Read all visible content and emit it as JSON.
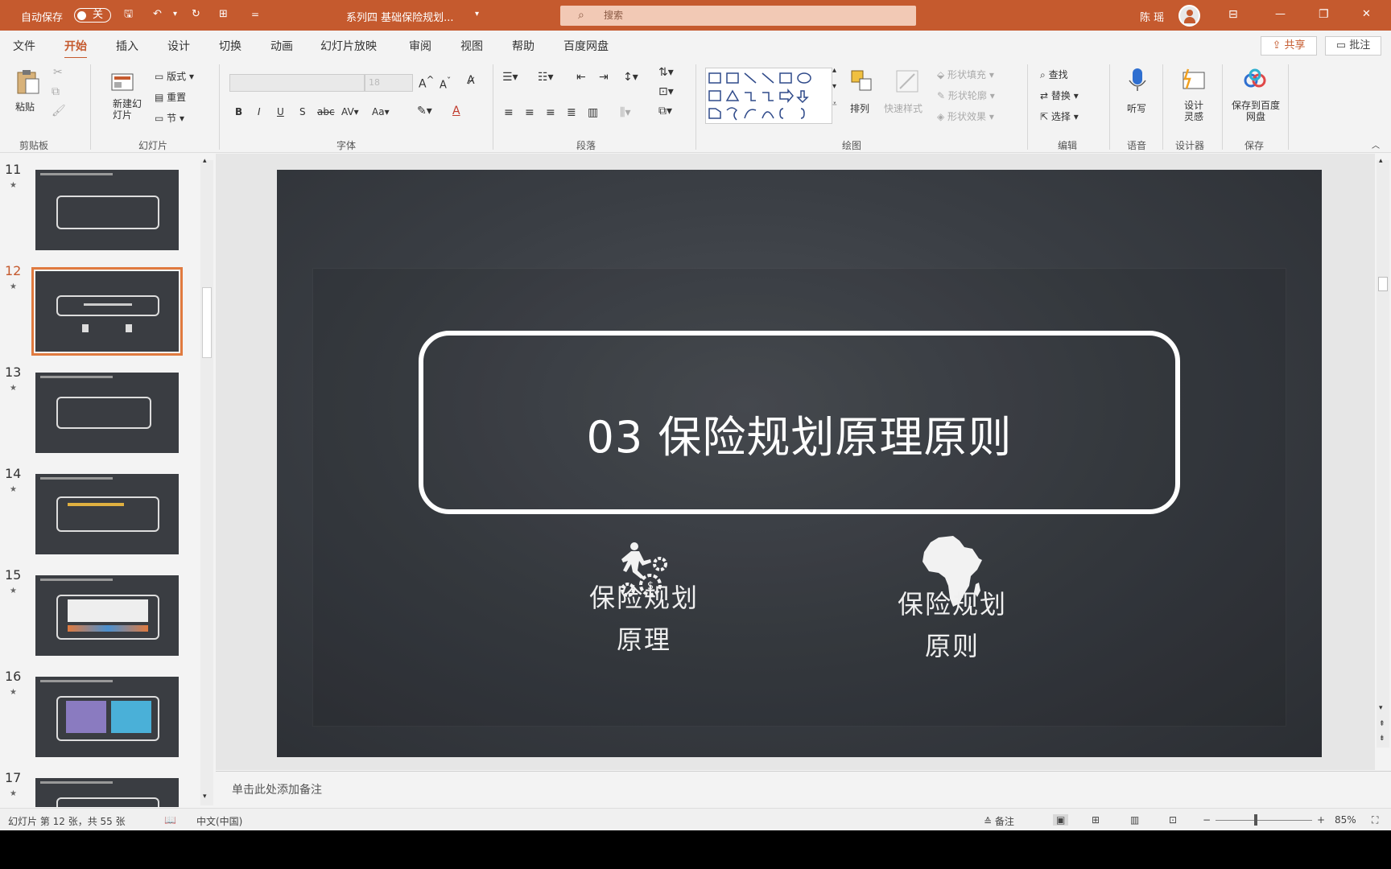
{
  "titlebar": {
    "autosave_label": "自动保存",
    "autosave_state": "关",
    "doc_title": "系列四 基础保险规划...",
    "search_placeholder": "搜索",
    "user_name": "陈 瑶"
  },
  "tabs": [
    "文件",
    "开始",
    "插入",
    "设计",
    "切换",
    "动画",
    "幻灯片放映",
    "审阅",
    "视图",
    "帮助",
    "百度网盘"
  ],
  "active_tab": "开始",
  "share_label": "共享",
  "comment_label": "批注",
  "ribbon": {
    "clipboard": {
      "paste": "粘贴",
      "label": "剪贴板"
    },
    "slides": {
      "new_slide": "新建幻灯片",
      "layout": "版式",
      "reset": "重置",
      "section": "节",
      "label": "幻灯片"
    },
    "font": {
      "size": "18",
      "label": "字体"
    },
    "paragraph": {
      "label": "段落"
    },
    "drawing": {
      "arrange": "排列",
      "quick_styles": "快速样式",
      "fill": "形状填充",
      "outline": "形状轮廓",
      "effects": "形状效果",
      "label": "绘图"
    },
    "editing": {
      "find": "查找",
      "replace": "替换",
      "select": "选择",
      "label": "编辑"
    },
    "voice": {
      "dictate": "听写",
      "label": "语音"
    },
    "designer": {
      "design_ideas": "设计灵感",
      "label": "设计器"
    },
    "save": {
      "save_to_baidu": "保存到百度网盘",
      "label": "保存"
    }
  },
  "thumbnails": [
    {
      "num": "11",
      "star": "★"
    },
    {
      "num": "12",
      "star": "★"
    },
    {
      "num": "13",
      "star": "★"
    },
    {
      "num": "14",
      "star": "★"
    },
    {
      "num": "15",
      "star": "★"
    },
    {
      "num": "16",
      "star": "★"
    },
    {
      "num": "17",
      "star": "★"
    }
  ],
  "selected_slide": "12",
  "slide": {
    "title": "03  保险规划原理原则",
    "left_caption_line1": "保险规划",
    "left_caption_line2": "原理",
    "right_caption_line1": "保险规划",
    "right_caption_line2": "原则",
    "left_icon": "runner-gears-icon",
    "right_icon": "africa-map-icon"
  },
  "notes_placeholder": "单击此处添加备注",
  "status": {
    "slide_info": "幻灯片 第 12 张，共 55 张",
    "language": "中文(中国)",
    "notes_btn": "备注",
    "zoom": "85%"
  },
  "colors": {
    "accent": "#c55a2e",
    "slide_bg": "#3a3e44"
  }
}
